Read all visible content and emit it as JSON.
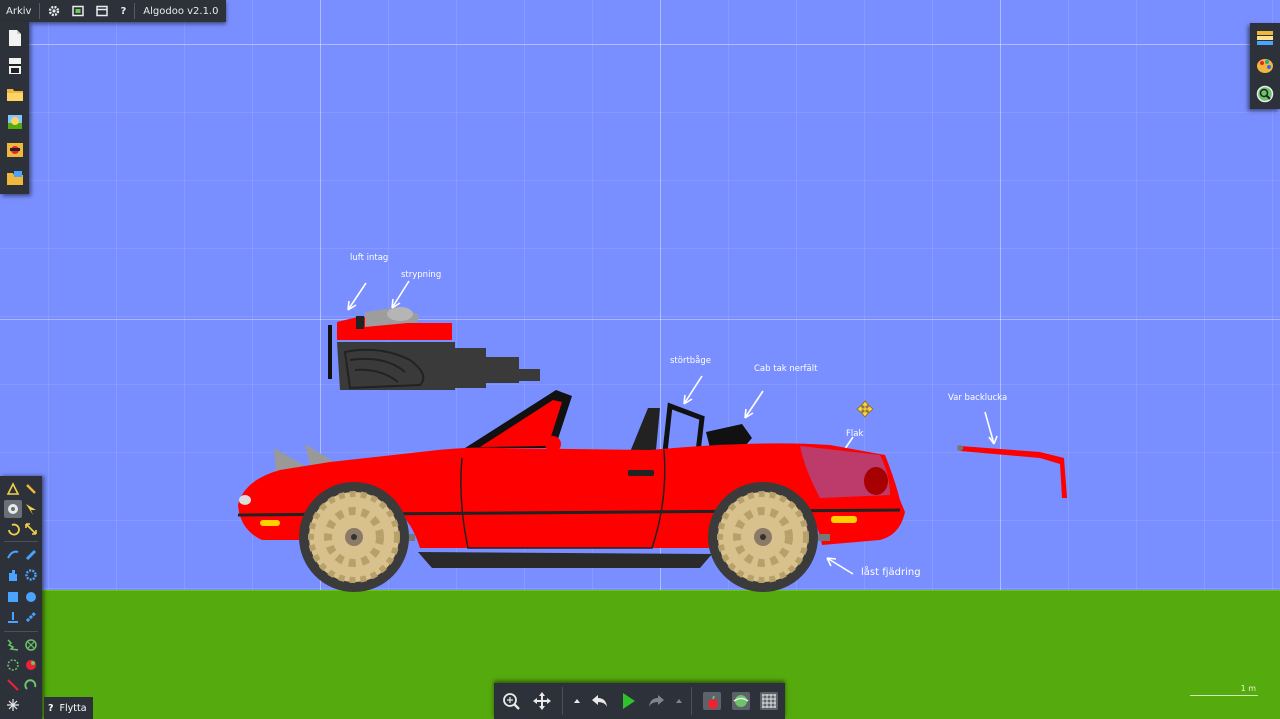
{
  "app": {
    "menu_label": "Arkiv",
    "version_label": "Algodoo v2.1.0",
    "help_label": "?"
  },
  "annotations": {
    "air_intake": "luft intag",
    "throttle": "strypning",
    "roll_bar": "störtbåge",
    "soft_top": "Cab tak nerfält",
    "trunk": "Flak",
    "was_trunk_lid": "Var backlucka",
    "locked_suspension": "låst fjädring"
  },
  "status": {
    "tool_label": "Flytta",
    "tool_help": "?"
  },
  "scale": {
    "label": "1 m"
  },
  "colors": {
    "sky": "#7a8fff",
    "ground": "#55aa0e",
    "car_body": "#ff0000",
    "toolbar": "#2d323a"
  },
  "icons": {
    "top": [
      "gear-icon",
      "window-icon",
      "panel-icon",
      "help-icon"
    ],
    "left": [
      "new-file-icon",
      "clear-scene-icon",
      "open-folder-icon",
      "scene-thumbnail-icon",
      "photo-icon",
      "save-folder-icon"
    ],
    "right": [
      "layers-icon",
      "palette-icon",
      "options-icon"
    ],
    "bottom": [
      "zoom-icon",
      "pan-icon",
      "undo-icon",
      "play-icon",
      "redo-icon",
      "gravity-icon",
      "air-icon",
      "grid-icon"
    ]
  }
}
